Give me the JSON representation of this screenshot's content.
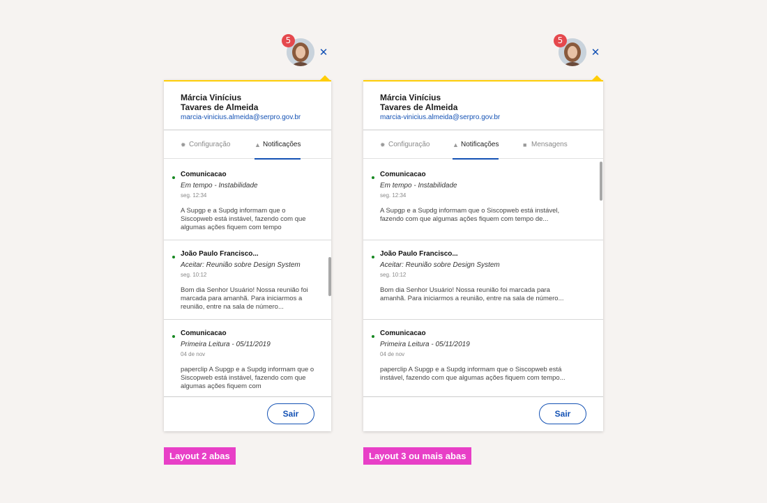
{
  "colors": {
    "accent": "#1351b4",
    "warning": "#ffcd07",
    "badge": "#e5484d",
    "tag": "#e83fc7",
    "unread": "#168821"
  },
  "badge_count": "5",
  "user": {
    "name_line1": "Márcia Vinícius",
    "name_line2": "Tavares de Almeida",
    "email": "marcia-vinicius.almeida@serpro.gov.br"
  },
  "tabs": {
    "config": {
      "label": "Configuração",
      "icon": "gear-icon"
    },
    "notif": {
      "label": "Notificações",
      "icon": "bell-icon"
    },
    "messages": {
      "label": "Mensagens",
      "icon": "envelope-icon"
    }
  },
  "left": {
    "items": [
      {
        "title": "Comunicacao",
        "subtitle": "Em tempo - Instabilidade",
        "time": "seg. 12:34",
        "body": "A Supgp e a Supdg informam que o Siscopweb está instável, fazendo com que algumas ações fiquem com tempo"
      },
      {
        "title": "João Paulo Francisco...",
        "subtitle": "Aceitar: Reunião sobre Design System",
        "time": "seg. 10:12",
        "body": "Bom dia Senhor Usuário!  Nossa reunião foi marcada para amanhã. Para iniciarmos a reunião, entre na sala de número..."
      },
      {
        "title": "Comunicacao",
        "subtitle": "Primeira Leitura - 05/11/2019",
        "time": "04 de nov",
        "body": "paperclip  A Supgp e a Supdg informam que o Siscopweb está instável, fazendo com que algumas ações fiquem com"
      }
    ]
  },
  "right": {
    "items": [
      {
        "title": "Comunicacao",
        "subtitle": "Em tempo - Instabilidade",
        "time": "seg. 12:34",
        "body": "A Supgp e a Supdg informam que o Siscopweb está instável, fazendo com que algumas ações fiquem com tempo de..."
      },
      {
        "title": "João Paulo Francisco...",
        "subtitle": "Aceitar: Reunião sobre Design System",
        "time": "seg. 10:12",
        "body": "Bom dia Senhor Usuário!  Nossa reunião foi marcada para amanhã. Para iniciarmos a reunião, entre na sala de número..."
      },
      {
        "title": "Comunicacao",
        "subtitle": "Primeira Leitura - 05/11/2019",
        "time": "04 de nov",
        "body": "paperclip  A Supgp e a Supdg informam que o Siscopweb está instável, fazendo com que algumas ações fiquem com tempo..."
      }
    ]
  },
  "logout_label": "Sair",
  "labels": {
    "left": "Layout 2 abas",
    "right": "Layout 3 ou mais abas"
  }
}
